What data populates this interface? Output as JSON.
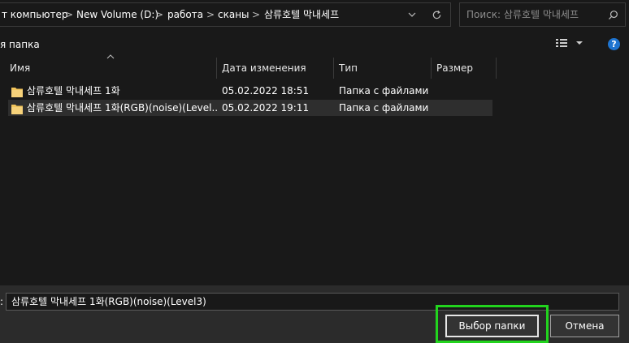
{
  "address_bar": {
    "crumbs": [
      "т компьютер",
      "New Volume (D:)",
      "работа",
      "сканы",
      "삼류호텔 막내세프"
    ],
    "separator": ">"
  },
  "search": {
    "placeholder": "Поиск: 삼류호텔 막내세프"
  },
  "toolbar": {
    "new_folder_label": "я папка"
  },
  "columns": {
    "name": "Имя",
    "date": "Дата изменения",
    "type": "Тип",
    "size": "Размер"
  },
  "rows": [
    {
      "name": "삼류호텔 막내세프 1화",
      "date": "05.02.2022 18:51",
      "type": "Папка с файлами",
      "size": ""
    },
    {
      "name": "삼류호텔 막내세프 1화(RGB)(noise)(Level...",
      "date": "05.02.2022 19:11",
      "type": "Папка с файлами",
      "size": ""
    }
  ],
  "filename": {
    "label": ":",
    "value": "삼류호텔 막내세프 1화(RGB)(noise)(Level3)"
  },
  "buttons": {
    "select_folder": "Выбор папки",
    "cancel": "Отмена"
  },
  "icons": {
    "dropdown": "chevron-down-icon",
    "refresh": "refresh-icon",
    "search": "search-icon",
    "view": "view-options-icon",
    "help": "help-icon",
    "folder": "folder-icon"
  },
  "colors": {
    "background": "#191919",
    "selected_row": "#2e2e2e",
    "highlight": "#22d41e",
    "help_blue": "#1e74d0",
    "folder_yellow": "#f2c55c"
  }
}
